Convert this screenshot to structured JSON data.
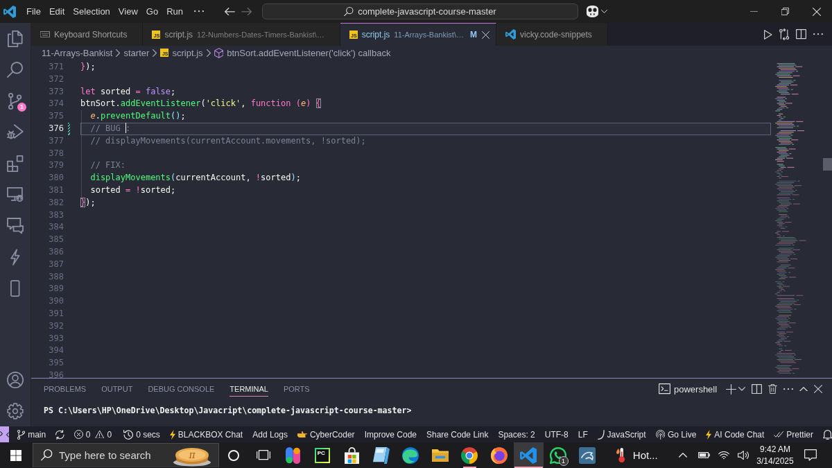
{
  "title_bar": {
    "menu": [
      "File",
      "Edit",
      "Selection",
      "View",
      "Go",
      "Run"
    ],
    "nav": [
      {
        "kind": "back",
        "disabled": false
      },
      {
        "kind": "forward",
        "disabled": true
      }
    ],
    "command_center": "complete-javascript-course-master"
  },
  "activity_bar": {
    "top": [
      {
        "kind": "explorer"
      },
      {
        "kind": "search"
      },
      {
        "kind": "source-control",
        "badge": "1"
      },
      {
        "kind": "run-debug"
      },
      {
        "kind": "extensions"
      },
      {
        "kind": "remote-explorer"
      },
      {
        "kind": "chat"
      },
      {
        "kind": "blackbox"
      },
      {
        "kind": "device"
      }
    ],
    "bottom": [
      {
        "kind": "account"
      },
      {
        "kind": "settings"
      }
    ]
  },
  "tabs": [
    {
      "kind": "shortcuts",
      "label": "Keyboard Shortcuts",
      "selected": false,
      "close_button": false
    },
    {
      "kind": "script",
      "icon_text": "JS",
      "label": "script.js",
      "description": "12-Numbers-Dates-Timers-Bankist\\…",
      "selected": false,
      "close_button": false
    },
    {
      "kind": "script",
      "icon_text": "JS",
      "label": "script.js",
      "description": "11-Arrays-Bankist\\…",
      "status": "M",
      "selected": true,
      "close_button": true
    },
    {
      "kind": "snippets",
      "label": "vicky.code-snippets",
      "selected": false,
      "close_button": false
    }
  ],
  "editor_actions": [
    {
      "kind": "run"
    },
    {
      "kind": "compare"
    },
    {
      "kind": "split"
    },
    {
      "kind": "more"
    }
  ],
  "breadcrumbs": [
    {
      "kind": "folder",
      "label": "11-Arrays-Bankist"
    },
    {
      "kind": "folder",
      "label": "starter"
    },
    {
      "kind": "file",
      "icon_text": "JS",
      "label": "script.js"
    },
    {
      "kind": "symbol",
      "label": "btnSort.addEventListener('click') callback"
    }
  ],
  "editor": {
    "lines": [
      {
        "number": "371",
        "current": false,
        "modified": false,
        "tokens": [
          {
            "text": "}",
            "kind": "bracket1"
          },
          {
            "text": ");",
            "kind": "plain"
          }
        ]
      },
      {
        "number": "372",
        "current": false,
        "modified": false
      },
      {
        "number": "373",
        "current": false,
        "modified": false,
        "tokens": [
          {
            "text": "let",
            "kind": "keyword"
          },
          {
            "text": " sorted ",
            "kind": "plain"
          },
          {
            "text": "= ",
            "kind": "operator"
          },
          {
            "text": "false",
            "kind": "constant"
          },
          {
            "text": ";",
            "kind": "plain"
          }
        ]
      },
      {
        "number": "374",
        "current": false,
        "modified": false,
        "tokens": [
          {
            "text": "btnSort.",
            "kind": "plain"
          },
          {
            "text": "addEventListener",
            "kind": "function"
          },
          {
            "text": "(",
            "kind": "plain"
          },
          {
            "text": "'click'",
            "kind": "string"
          },
          {
            "text": ", ",
            "kind": "plain"
          },
          {
            "text": "function ",
            "kind": "keyword"
          },
          {
            "text": "(",
            "kind": "bracket1"
          },
          {
            "text": "e",
            "kind": "param"
          },
          {
            "text": ") ",
            "kind": "bracket1"
          },
          {
            "text": "{",
            "kind": "bracket-match"
          }
        ],
        "children": [
          {
            "number": "375",
            "current": false,
            "modified": false,
            "tokens": [
              {
                "text": "e",
                "kind": "param"
              },
              {
                "text": ".",
                "kind": "plain"
              },
              {
                "text": "preventDefault",
                "kind": "function"
              },
              {
                "text": "()",
                "kind": "bracket2"
              },
              {
                "text": ";",
                "kind": "plain"
              }
            ]
          },
          {
            "number": "376",
            "current": true,
            "modified": true,
            "tokens": [
              {
                "text": "// BUG ",
                "kind": "comment"
              },
              {
                "kind": "cursor"
              },
              {
                "text": ":",
                "kind": "comment"
              }
            ]
          },
          {
            "number": "377",
            "current": false,
            "modified": false,
            "tokens": [
              {
                "text": "// displayMovements(currentAccount.movements, !sorted);",
                "kind": "comment"
              }
            ]
          },
          {
            "number": "378",
            "current": false,
            "modified": false
          },
          {
            "number": "379",
            "current": false,
            "modified": false,
            "tokens": [
              {
                "text": "// FIX:",
                "kind": "comment"
              }
            ]
          },
          {
            "number": "380",
            "current": false,
            "modified": false,
            "tokens": [
              {
                "text": "displayMovements",
                "kind": "function"
              },
              {
                "text": "(",
                "kind": "bracket2"
              },
              {
                "text": "currentAccount, ",
                "kind": "plain"
              },
              {
                "text": "!",
                "kind": "operator"
              },
              {
                "text": "sorted",
                "kind": "plain"
              },
              {
                "text": ")",
                "kind": "bracket2"
              },
              {
                "text": ";",
                "kind": "plain"
              }
            ]
          },
          {
            "number": "381",
            "current": false,
            "modified": false,
            "tokens": [
              {
                "text": "sorted ",
                "kind": "plain"
              },
              {
                "text": "= !",
                "kind": "operator"
              },
              {
                "text": "sorted;",
                "kind": "plain"
              }
            ]
          }
        ]
      },
      {
        "number": "382",
        "current": false,
        "modified": false,
        "tokens": [
          {
            "text": "}",
            "kind": "bracket-match"
          },
          {
            "text": ");",
            "kind": "plain"
          }
        ]
      },
      {
        "number": "383",
        "current": false,
        "modified": false
      },
      {
        "number": "384",
        "current": false,
        "modified": false
      },
      {
        "number": "385",
        "current": false,
        "modified": false
      },
      {
        "number": "386",
        "current": false,
        "modified": false
      },
      {
        "number": "387",
        "current": false,
        "modified": false
      },
      {
        "number": "388",
        "current": false,
        "modified": false
      },
      {
        "number": "389",
        "current": false,
        "modified": false
      },
      {
        "number": "390",
        "current": false,
        "modified": false
      },
      {
        "number": "391",
        "current": false,
        "modified": false
      },
      {
        "number": "392",
        "current": false,
        "modified": false
      },
      {
        "number": "393",
        "current": false,
        "modified": false
      },
      {
        "number": "394",
        "current": false,
        "modified": false
      },
      {
        "number": "395",
        "current": false,
        "modified": false
      },
      {
        "number": "396",
        "current": false,
        "modified": false
      }
    ]
  },
  "panel": {
    "tabs": [
      {
        "label": "PROBLEMS",
        "selected": false
      },
      {
        "label": "OUTPUT",
        "selected": false
      },
      {
        "label": "DEBUG CONSOLE",
        "selected": false
      },
      {
        "label": "TERMINAL",
        "selected": true
      },
      {
        "label": "PORTS",
        "selected": false
      }
    ],
    "terminal_profile": "powershell",
    "actions": [
      {
        "kind": "new"
      },
      {
        "kind": "launch-menu"
      },
      {
        "kind": "split"
      },
      {
        "kind": "kill"
      },
      {
        "kind": "more"
      },
      {
        "kind": "maximize"
      },
      {
        "kind": "close"
      }
    ],
    "terminal_lines": [
      "PS C:\\Users\\HP\\OneDrive\\Desktop\\Javacript\\complete-javascript-course-master>"
    ]
  },
  "status_bar": {
    "left": [
      {
        "kind": "remote"
      },
      {
        "kind": "branch",
        "text": "main"
      },
      {
        "kind": "sync"
      },
      {
        "kind": "problems",
        "errors": "0",
        "warnings": "0"
      },
      {
        "kind": "timer",
        "text": "0 secs"
      },
      {
        "kind": "blackbox",
        "text": "BLACKBOX Chat"
      },
      {
        "kind": "text",
        "text": "Add Logs"
      },
      {
        "kind": "cybercoder",
        "text": "CyberCoder"
      },
      {
        "kind": "text",
        "text": "Improve Code"
      },
      {
        "kind": "text",
        "text": "Share Code Link"
      }
    ],
    "right": [
      {
        "kind": "text",
        "text": "Spaces: 2"
      },
      {
        "kind": "text",
        "text": "UTF-8"
      },
      {
        "kind": "text",
        "text": "LF"
      },
      {
        "kind": "language",
        "text": "JavaScript"
      },
      {
        "kind": "live",
        "text": "Go Live"
      },
      {
        "kind": "ai-chat",
        "text": "AI Code Chat"
      },
      {
        "kind": "prettier",
        "text": "Prettier"
      },
      {
        "kind": "notifications"
      }
    ]
  },
  "taskbar": {
    "search": {
      "placeholder": "Type here to search",
      "doodle_text": "π"
    },
    "system_buttons": [
      {
        "kind": "cortana"
      },
      {
        "kind": "task-view"
      }
    ],
    "apps": [
      {
        "kind": "copilot",
        "selected": false,
        "running": false
      },
      {
        "kind": "pycharm",
        "icon_text": "PC",
        "selected": false,
        "running": false
      },
      {
        "kind": "store",
        "selected": false,
        "running": false
      },
      {
        "kind": "crystal",
        "selected": false,
        "running": false
      },
      {
        "kind": "edge",
        "selected": false,
        "running": false
      },
      {
        "kind": "explorer",
        "selected": false,
        "running": false
      },
      {
        "kind": "chrome",
        "selected": false,
        "running": true
      },
      {
        "kind": "firefox",
        "selected": false,
        "running": false
      },
      {
        "kind": "vscode",
        "selected": true,
        "running": true
      },
      {
        "kind": "whatsapp",
        "badge": "1",
        "selected": false,
        "running": false
      },
      {
        "kind": "mysql",
        "selected": false,
        "running": false
      }
    ],
    "weather": {
      "text": "Hot..."
    },
    "tray": [
      {
        "kind": "overflow"
      },
      {
        "kind": "battery"
      },
      {
        "kind": "wifi"
      },
      {
        "kind": "volume"
      }
    ],
    "clock": {
      "time": "9:42 AM",
      "date": "3/14/2025"
    }
  }
}
